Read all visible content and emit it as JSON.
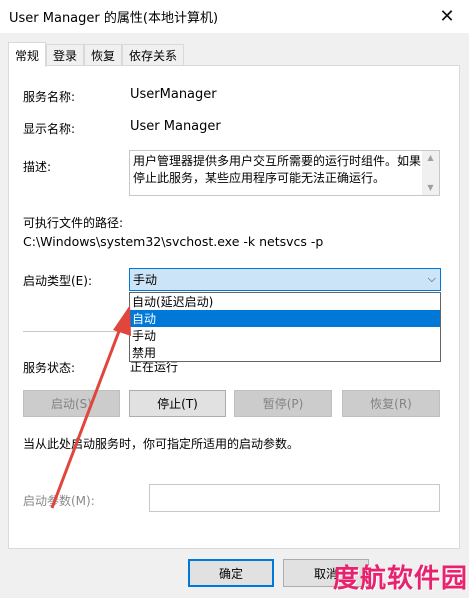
{
  "window": {
    "title": "User Manager 的属性(本地计算机)",
    "close_glyph": "✕"
  },
  "tabs": [
    {
      "label": "常规",
      "active": true
    },
    {
      "label": "登录"
    },
    {
      "label": "恢复"
    },
    {
      "label": "依存关系"
    }
  ],
  "general": {
    "service_name_label": "服务名称:",
    "service_name_value": "UserManager",
    "display_name_label": "显示名称:",
    "display_name_value": "User Manager",
    "description_label": "描述:",
    "description_value": "用户管理器提供多用户交互所需要的运行时组件。如果停止此服务，某些应用程序可能无法正确运行。",
    "exe_path_label": "可执行文件的路径:",
    "exe_path_value": "C:\\Windows\\system32\\svchost.exe -k netsvcs -p",
    "startup_type_label": "启动类型(E):",
    "startup_type_value": "手动",
    "startup_options": [
      "自动(延迟启动)",
      "自动",
      "手动",
      "禁用"
    ],
    "highlighted_option": "自动",
    "service_status_label": "服务状态:",
    "service_status_value": "正在运行",
    "start_button": "启动(S)",
    "stop_button": "停止(T)",
    "pause_button": "暂停(P)",
    "resume_button": "恢复(R)",
    "hint_text": "当从此处启动服务时，你可指定所适用的启动参数。",
    "start_params_label": "启动参数(M):",
    "start_params_value": ""
  },
  "footer": {
    "ok_button": "确定",
    "cancel_button": "取消"
  },
  "watermark": "度航软件园",
  "icons": {
    "close": "close-icon",
    "chevron": "chevron-down-icon",
    "scroll_up": "scroll-up-icon",
    "scroll_down": "scroll-down-icon"
  },
  "colors": {
    "accent": "#0078d7",
    "annotation_arrow": "#e0463b",
    "watermark": "#e8226f"
  }
}
